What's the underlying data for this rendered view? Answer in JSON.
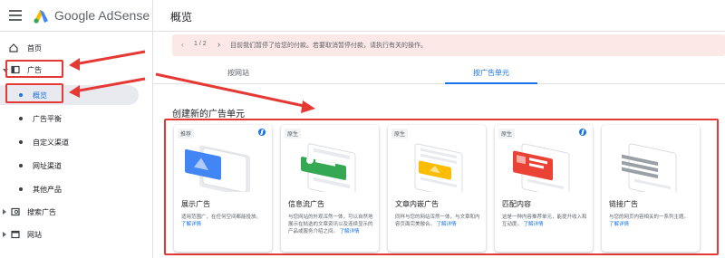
{
  "app": {
    "brand_google": "Google",
    "brand_product": "AdSense",
    "page_title": "概览"
  },
  "sidebar": {
    "items": [
      {
        "label": "首页",
        "icon": "home-icon"
      },
      {
        "label": "广告",
        "icon": "ads-icon"
      },
      {
        "label": "概览",
        "icon": "bullet"
      },
      {
        "label": "广告平衡",
        "icon": "bullet"
      },
      {
        "label": "自定义渠道",
        "icon": "bullet"
      },
      {
        "label": "网址渠道",
        "icon": "bullet"
      },
      {
        "label": "其他产品",
        "icon": "bullet"
      },
      {
        "label": "搜索广告",
        "icon": "search-ads-icon"
      },
      {
        "label": "网站",
        "icon": "sites-icon"
      }
    ]
  },
  "banner": {
    "pager": "1 / 2",
    "message": "目前我们暂停了给您的付款。若要取消暂停付款，请执行有关的操作。"
  },
  "tabs": [
    {
      "label": "按网站",
      "active": false
    },
    {
      "label": "按广告单元",
      "active": true
    }
  ],
  "section_title": "创建新的广告单元",
  "cards": [
    {
      "badge": "推荐",
      "title": "展示广告",
      "desc": "适用范围广，在任何空间都能投放。",
      "link": "了解详情",
      "bolt": true
    },
    {
      "badge": "原生",
      "title": "信息流广告",
      "desc": "与您网站的外观浑然一体，可以自然地展示在帖选的文章资讯以及连续显示的产品或服务介绍之间。",
      "link": "了解详情",
      "bolt": false
    },
    {
      "badge": "原生",
      "title": "文章内嵌广告",
      "desc": "同样与您的网站浑然一体，与文章和内容页面完美融合。",
      "link": "了解详情",
      "bolt": false
    },
    {
      "badge": "原生",
      "title": "匹配内容",
      "desc": "这是一种内容推荐单元，能提升收入和互动度。",
      "link": "了解详情",
      "bolt": true
    },
    {
      "badge": "",
      "title": "链接广告",
      "desc": "与您的网页内容相关的一系列主题。",
      "link": "了解详情",
      "bolt": false
    }
  ],
  "colors": {
    "accent": "#1a73e8",
    "annotation_red": "#e53935",
    "banner_bg": "#fce8e6"
  }
}
